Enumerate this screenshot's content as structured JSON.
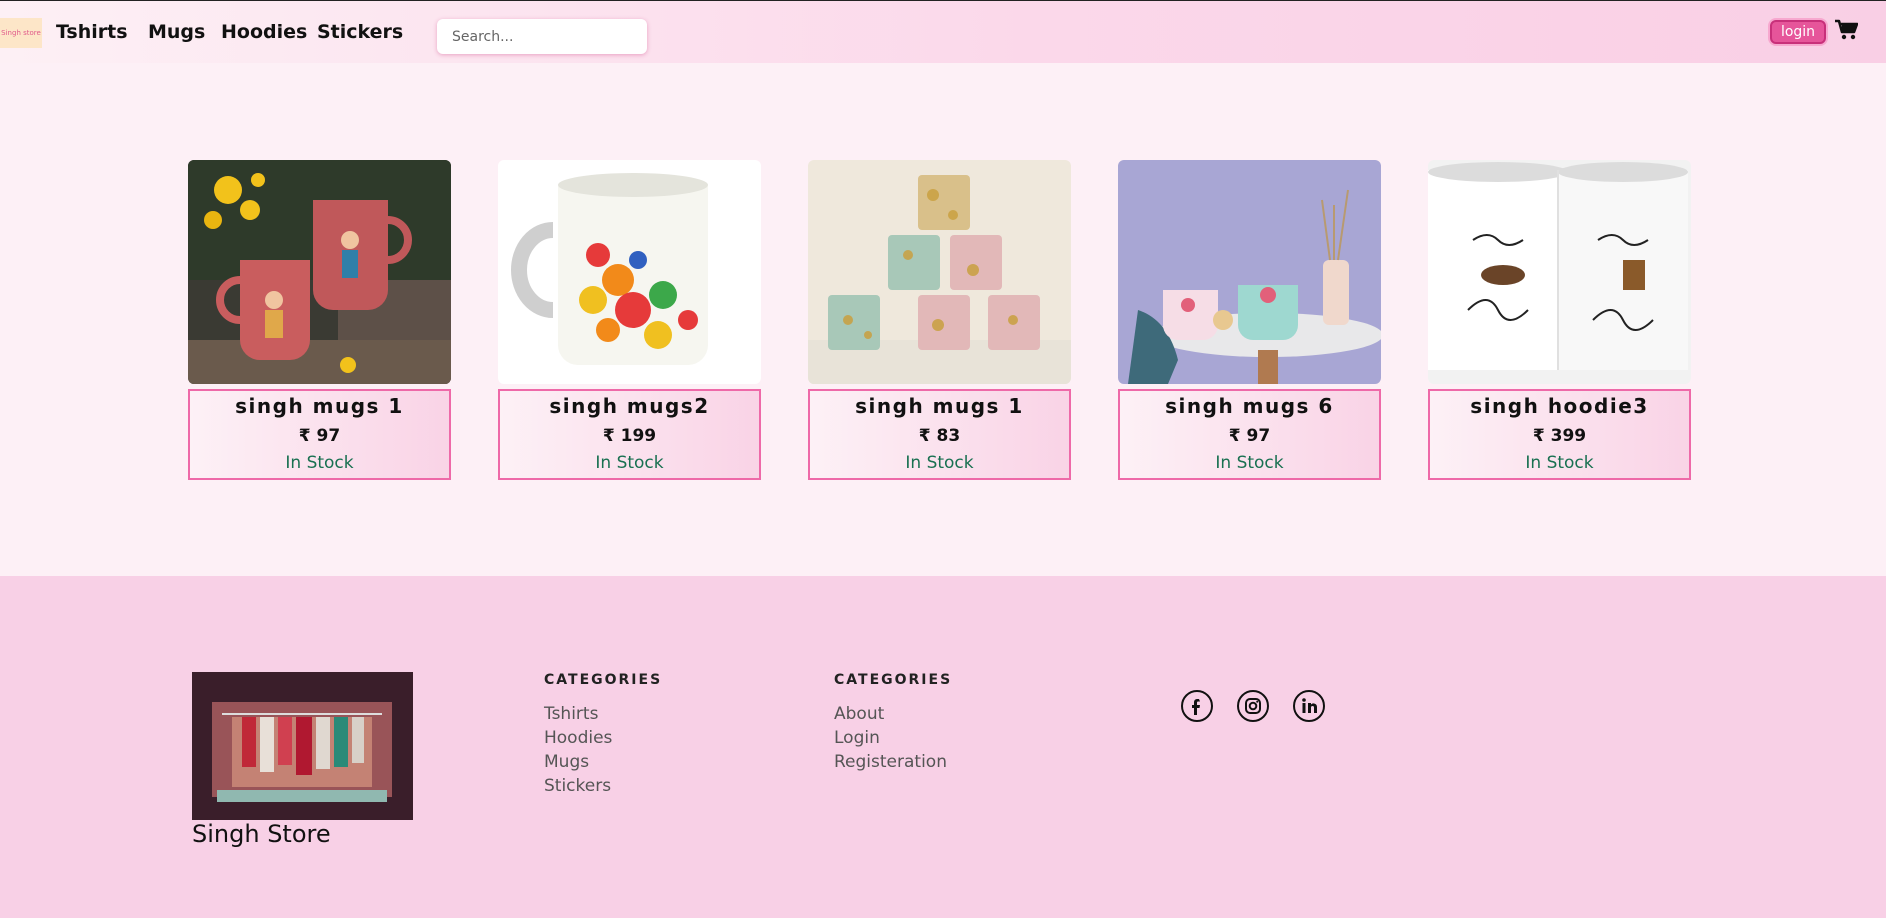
{
  "header": {
    "logo_text": "Singh store",
    "nav": [
      "Tshirts",
      "Mugs",
      "Hoodies",
      "Stickers"
    ],
    "search_placeholder": "Search...",
    "login_label": "login",
    "cart_icon": "cart-icon"
  },
  "products": [
    {
      "name": "singh mugs 1",
      "price": "₹ 97",
      "status": "In Stock"
    },
    {
      "name": "singh mugs2",
      "price": "₹ 199",
      "status": "In Stock"
    },
    {
      "name": "singh mugs 1",
      "price": "₹ 83",
      "status": "In Stock"
    },
    {
      "name": "singh mugs 6",
      "price": "₹ 97",
      "status": "In Stock"
    },
    {
      "name": "singh hoodie3",
      "price": "₹ 399",
      "status": "In Stock"
    }
  ],
  "footer": {
    "store_name": "Singh Store",
    "col1": {
      "title": "CATEGORIES",
      "links": [
        "Tshirts",
        "Hoodies",
        "Mugs",
        "Stickers"
      ]
    },
    "col2": {
      "title": "CATEGORIES",
      "links": [
        "About",
        "Login",
        "Registeration"
      ]
    },
    "social": [
      "facebook-icon",
      "instagram-icon",
      "linkedin-icon"
    ]
  },
  "colors": {
    "accent": "#e6559a",
    "border": "#ee69a8",
    "stock": "#187050",
    "footer_bg": "#f8d0e6"
  }
}
